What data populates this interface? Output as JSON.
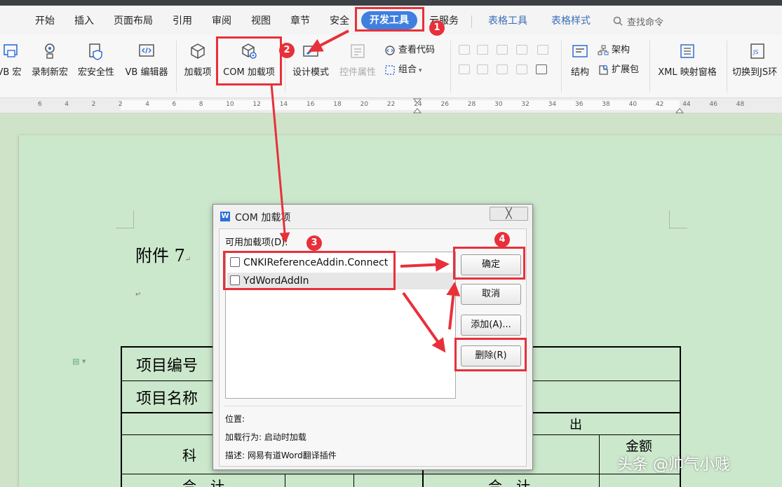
{
  "menu": {
    "tabs": [
      "开始",
      "插入",
      "页面布局",
      "引用",
      "审阅",
      "视图",
      "章节",
      "安全",
      "开发工具",
      "云服务",
      "表格工具",
      "表格样式"
    ],
    "active_tab": "开发工具",
    "search_placeholder": "查找命令"
  },
  "ribbon": {
    "vb_macro": "VB 宏",
    "record_macro": "录制新宏",
    "macro_security": "宏安全性",
    "vb_editor": "VB 编辑器",
    "addins": "加载项",
    "com_addins": "COM 加载项",
    "design_mode": "设计模式",
    "control_props": "控件属性",
    "view_code": "查看代码",
    "group": "组合",
    "structure": "结构",
    "schema": "架构",
    "expansion_pack": "扩展包",
    "xml_mapping": "XML 映射窗格",
    "switch_js": "切换到JS环"
  },
  "ruler": {
    "numbers": [
      "6",
      "4",
      "2",
      "2",
      "4",
      "6",
      "8",
      "10",
      "12",
      "14",
      "16",
      "18",
      "20",
      "22",
      "24",
      "26",
      "28",
      "30",
      "32",
      "34",
      "36",
      "38",
      "40",
      "42",
      "44",
      "46",
      "48"
    ]
  },
  "document": {
    "heading": "附件 7",
    "return_mark": "↵",
    "table": {
      "project_no": "项目编号",
      "project_name": "项目名称",
      "expense_partial": "出",
      "subject_partial": "科",
      "amount": "金额",
      "total_left": "合　计",
      "total_right": "合　计"
    }
  },
  "dialog": {
    "title": "COM 加载项",
    "close_glyph": "╳",
    "list_label": "可用加载项(D):",
    "items": [
      {
        "name": "CNKIReferenceAddin.Connect",
        "checked": false
      },
      {
        "name": "YdWordAddIn",
        "checked": false
      }
    ],
    "ok": "确定",
    "cancel": "取消",
    "add": "添加(A)...",
    "remove": "删除(R)",
    "location_label": "位置:",
    "load_behavior": "加载行为: 启动时加载",
    "description": "描述: 网易有道Word翻译插件"
  },
  "markers": [
    "1",
    "2",
    "3",
    "4"
  ],
  "watermark": "头条 @帅气小贱",
  "colors": {
    "accent": "#3f7fe0",
    "annotation": "#e8303a",
    "page": "#cce8cc"
  }
}
